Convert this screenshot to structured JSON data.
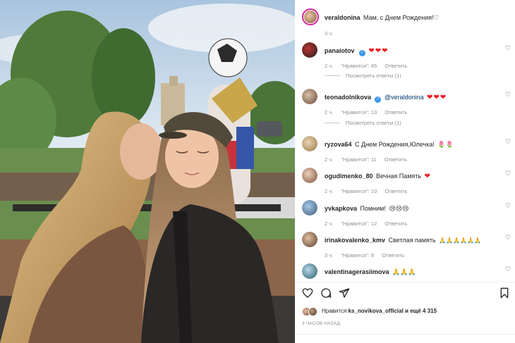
{
  "post": {
    "author": "veraldonina",
    "caption": "Мам, с Днем Рождения!♡",
    "time": "3 ч."
  },
  "comments": [
    {
      "user": "panaiotov",
      "verified": true,
      "text": "",
      "emoji": "❤❤❤",
      "time": "2 ч.",
      "likes": "\"Нравится\": 45",
      "reply": "Ответить",
      "view_replies": "Посмотреть ответы (1)"
    },
    {
      "user": "teonadolnikova",
      "verified": false,
      "mention": "@veraldonina",
      "emoji": "❤❤❤",
      "time": "2 ч.",
      "likes": "\"Нравится\": 13",
      "reply": "Ответить",
      "view_replies": "Посмотреть ответы (1)"
    },
    {
      "user": "ryzova64",
      "text": "С Днем Рождения,Юлечка!",
      "emoji": "🌷🌷",
      "time": "2 ч.",
      "likes": "\"Нравится\": 11",
      "reply": "Ответить"
    },
    {
      "user": "ogudimenko_80",
      "text": "Вечная Память",
      "emoji": "❤",
      "time": "2 ч.",
      "likes": "\"Нравится\": 10",
      "reply": "Ответить"
    },
    {
      "user": "yvkapkova",
      "text": "Помним!",
      "emoji": "😢😢😢",
      "time": "2 ч.",
      "likes": "\"Нравится\": 12",
      "reply": "Ответить"
    },
    {
      "user": "irinakovalenko_kmv",
      "text": "Светлая память",
      "emoji": "🙏🙏🙏🙏🙏🙏",
      "time": "3 ч.",
      "likes": "\"Нравится\": 8",
      "reply": "Ответить"
    },
    {
      "user": "valentinagerasiimova",
      "text": "",
      "emoji": "🙏🙏🙏",
      "time": "",
      "likes": "",
      "reply": ""
    }
  ],
  "likes": {
    "prefix": "Нравится",
    "user": "ks_novikova_official",
    "suffix": "и ещё 4 315"
  },
  "time_ago": "3 ЧАСОВ НАЗАД",
  "icons": {
    "like": "heart-icon",
    "comment": "comment-icon",
    "share": "send-icon",
    "save": "bookmark-icon"
  },
  "colors": {
    "heart_red": "#ed1c24",
    "verified_blue": "#3897f0",
    "muted": "#8e8e8e"
  }
}
